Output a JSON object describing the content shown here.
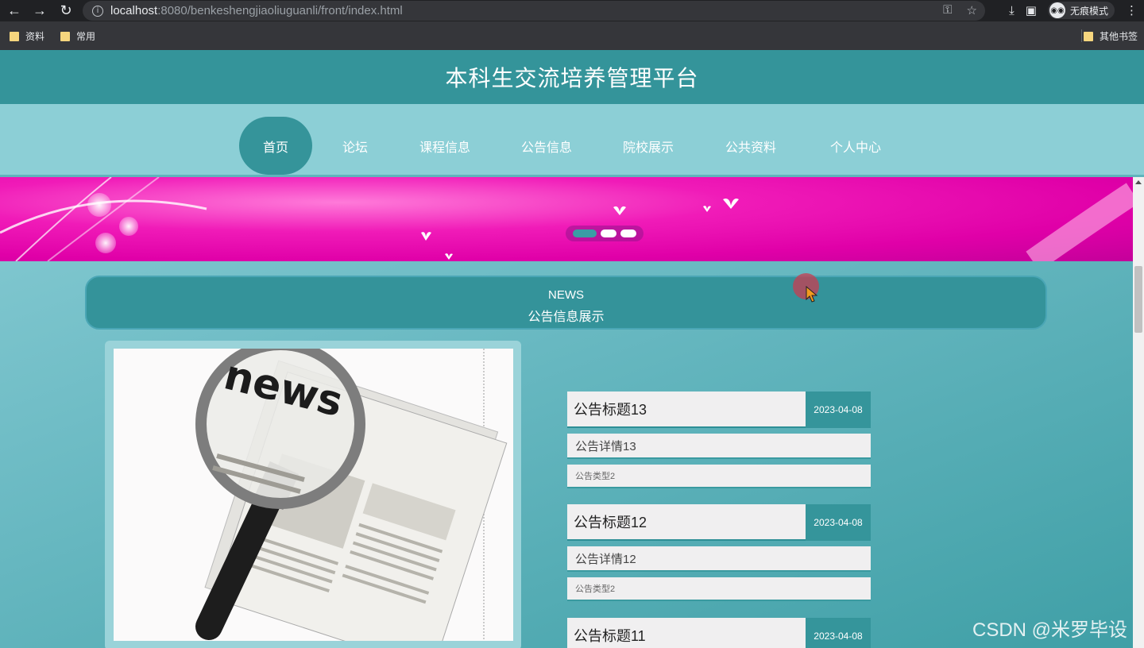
{
  "browser": {
    "url_host": "localhost",
    "url_path": ":8080/benkeshengjiaoliuguanli/front/index.html",
    "incognito_label": "无痕模式",
    "bookmarks": [
      "资料",
      "常用"
    ],
    "other_bookmarks": "其他书签"
  },
  "site": {
    "title": "本科生交流培养管理平台",
    "nav": [
      "首页",
      "论坛",
      "课程信息",
      "公告信息",
      "院校展示",
      "公共资料",
      "个人中心"
    ],
    "active_nav": "首页"
  },
  "banner": {
    "slides_count": 3,
    "active_slide": 1
  },
  "news_section": {
    "title_en": "NEWS",
    "title_cn": "公告信息展示",
    "image_alt_text": "news"
  },
  "news_items": [
    {
      "title": "公告标题13",
      "date": "2023-04-08",
      "detail": "公告详情13",
      "type": "公告类型2"
    },
    {
      "title": "公告标题12",
      "date": "2023-04-08",
      "detail": "公告详情12",
      "type": "公告类型2"
    },
    {
      "title": "公告标题11",
      "date": "2023-04-08",
      "detail": "",
      "type": ""
    }
  ],
  "watermark": "CSDN @米罗毕设",
  "colors": {
    "primary": "#34949a",
    "nav_bg": "#8ccfd6",
    "banner": "#e000a8"
  }
}
